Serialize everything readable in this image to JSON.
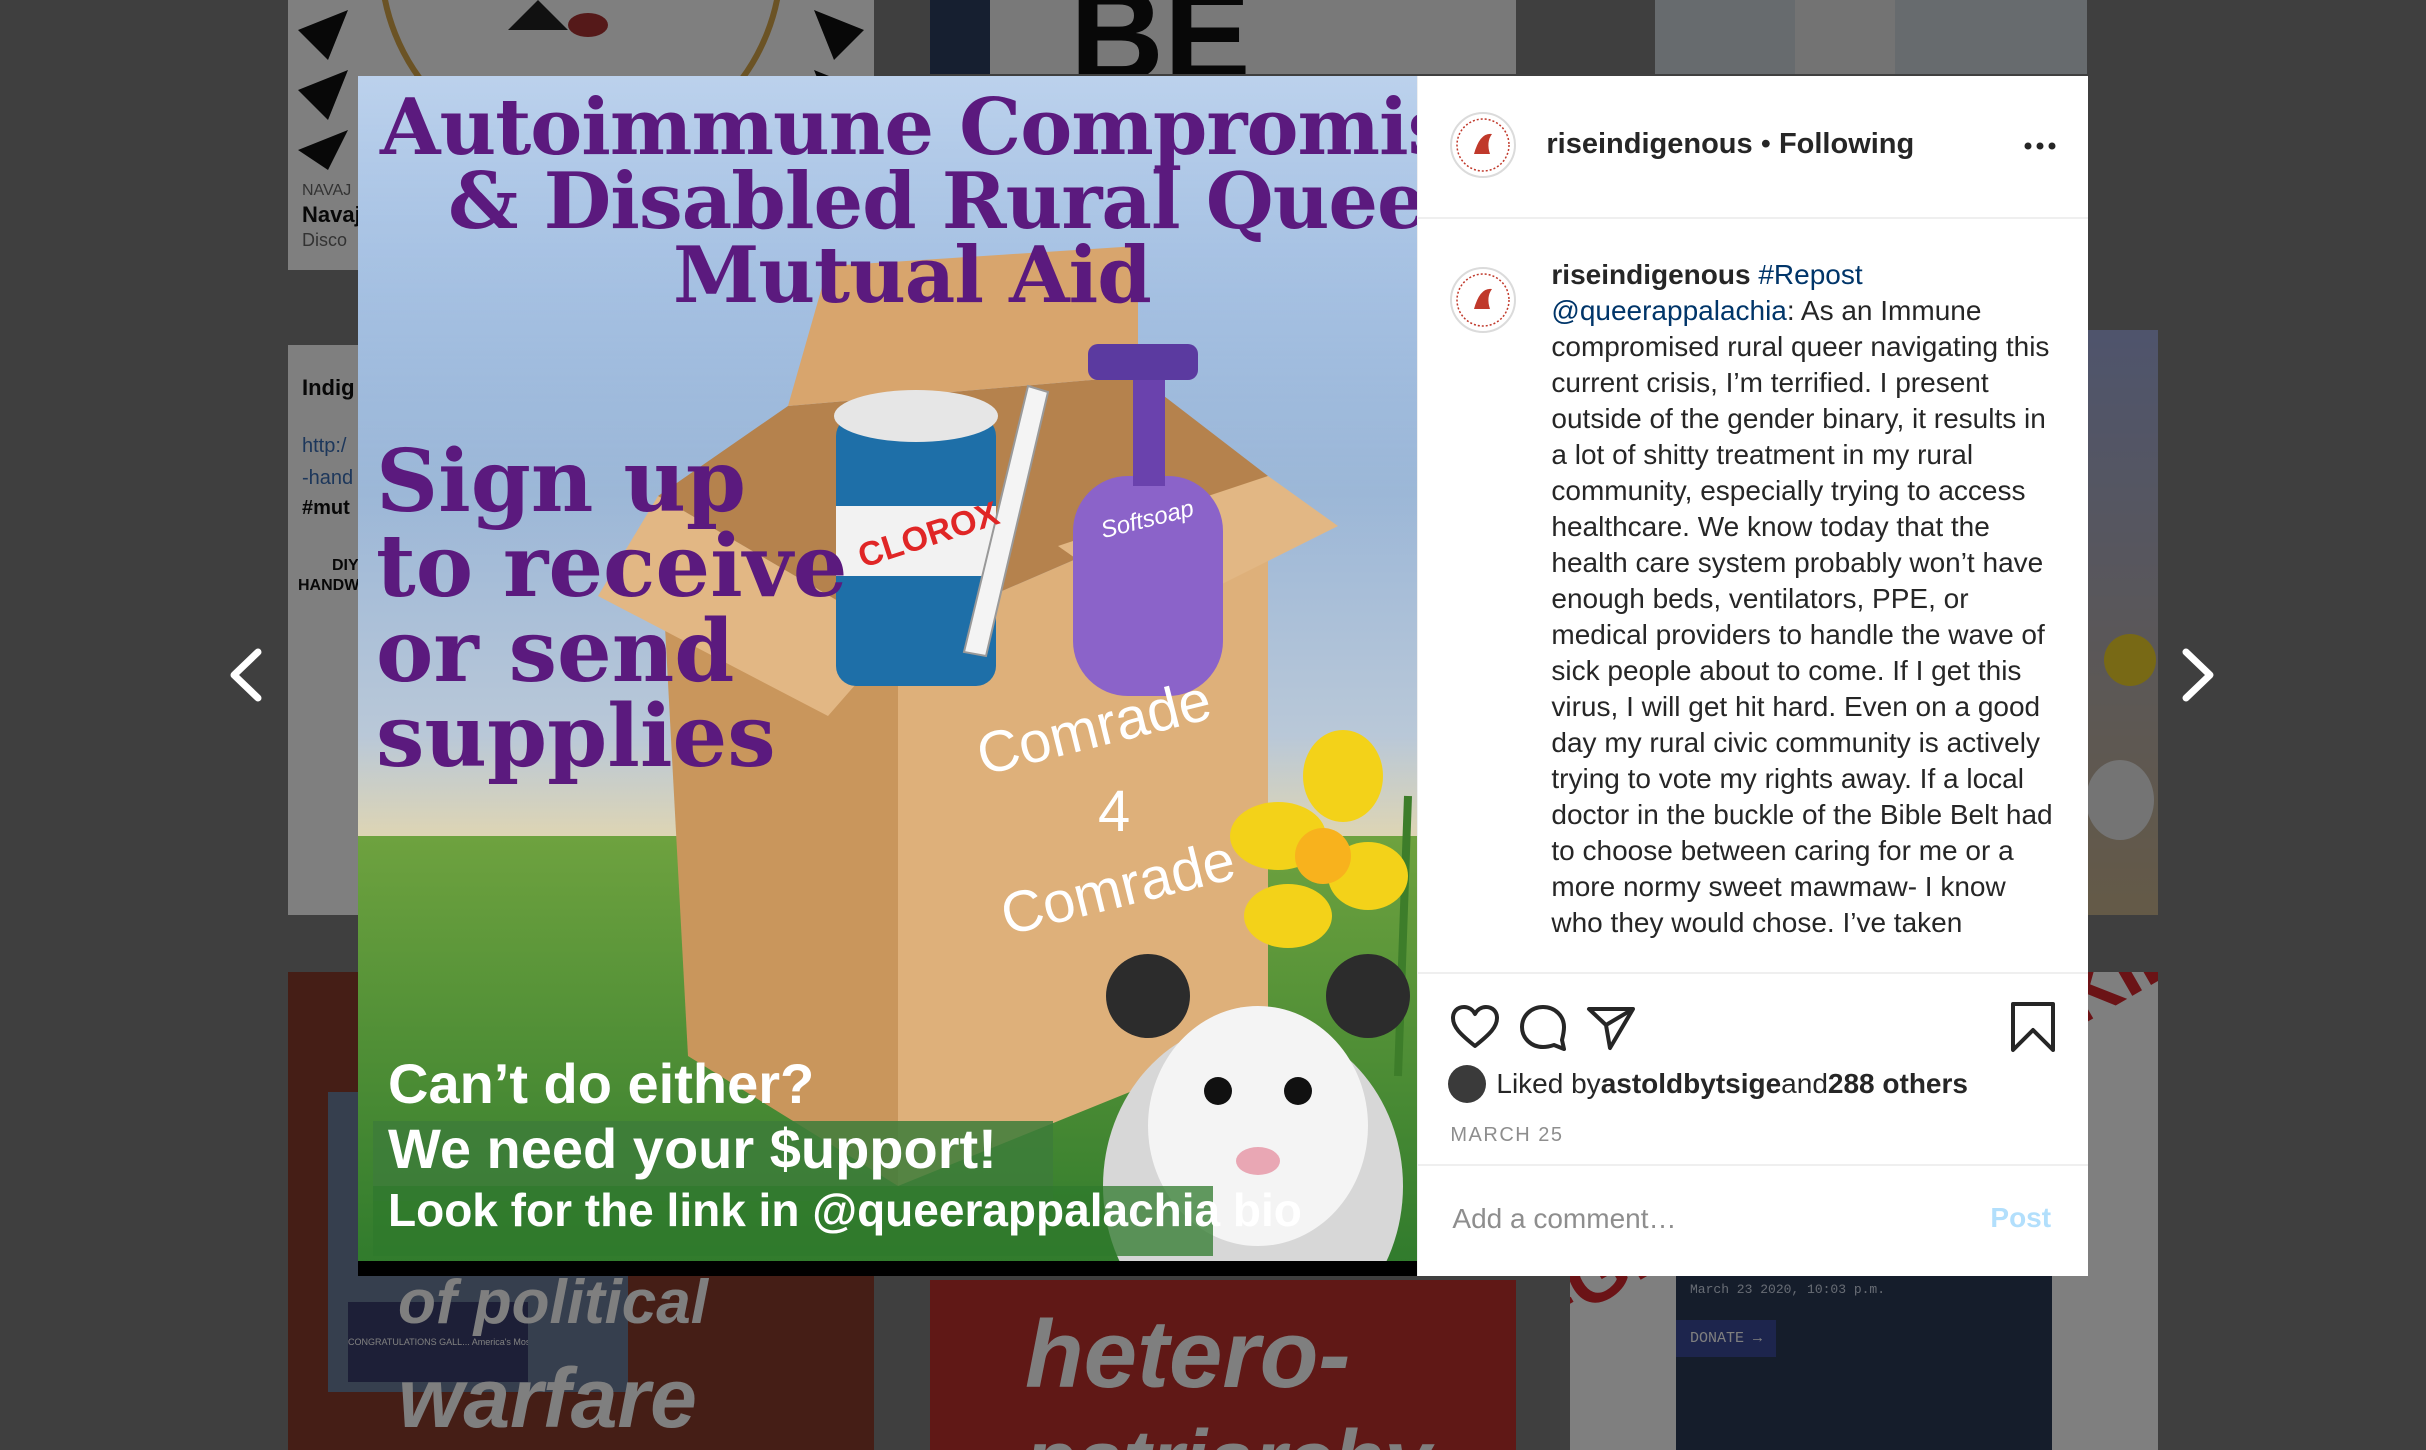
{
  "background": {
    "tile_navajo_small": "NAVAJ",
    "tile_navajo_title": "Navaj",
    "tile_navajo_sub": "Disco",
    "tile_indig": "Indig",
    "tile_link1": "http:/",
    "tile_link2": "-hand",
    "tile_tag": "#mut",
    "tile_diy1": "DIY",
    "tile_diy2": "HANDW",
    "tile_be": "BE",
    "tile_political1": "of political",
    "tile_political2": "warfare",
    "tile_hetero1": "hetero-",
    "tile_hetero2": "patriarchy",
    "tile_gilead": "#GILEADGREEDKILLS",
    "tile_date": "March 23 2020, 10:03 p.m.",
    "tile_donate": "DONATE →",
    "tile_sign": "CONGRATULATIONS GALL... America's Most Patriotic Small Town"
  },
  "media": {
    "headline": [
      "Autoimmune Compromised",
      "& Disabled Rural Queer",
      "Mutual Aid"
    ],
    "signup": [
      "Sign up",
      "to receive",
      "or send",
      "supplies"
    ],
    "box_text": [
      "Comrade",
      "4",
      "Comrade"
    ],
    "clorox": "CLOROX",
    "softsoap": "Softsoap",
    "bottom": [
      "Can’t do either?",
      "We need your $upport!",
      "Look for the link in @queerappalachia bio"
    ]
  },
  "header": {
    "username": "riseindigenous",
    "separator": " • ",
    "follow_status": "Following"
  },
  "caption": {
    "username": "riseindigenous",
    "hashtag": "#Repost",
    "mention": "@queerappalachia",
    "text": ": As an Immune compromised rural queer navigating this current crisis, I’m terrified. I present outside of the gender binary, it results in a lot of shitty treatment in my rural community, especially trying to access healthcare. We know today that the health care system probably won’t have enough beds, ventilators, PPE, or medical providers to handle the wave of sick people about to come. If I get this virus, I will get hit hard. Even on a good day my rural civic community is actively trying to vote my rights away. If a local doctor in the buckle of the Bible Belt had to choose between caring for me or a more normy sweet mawmaw- I know who they would chose. I’ve taken"
  },
  "likes": {
    "prefix": "Liked by ",
    "user": "astoldbytsige",
    "middle": " and ",
    "others": "288 others"
  },
  "date": "MARCH 25",
  "comment": {
    "placeholder": "Add a comment…",
    "post_label": "Post"
  },
  "colors": {
    "headline_purple": "#5b1a7e",
    "link_blue": "#003569",
    "post_disabled": "#b2dffc",
    "meta_gray": "#8e8e8e"
  },
  "icons": [
    "chevron-left-icon",
    "chevron-right-icon",
    "more-options-icon",
    "heart-icon",
    "comment-icon",
    "share-icon",
    "bookmark-icon"
  ]
}
